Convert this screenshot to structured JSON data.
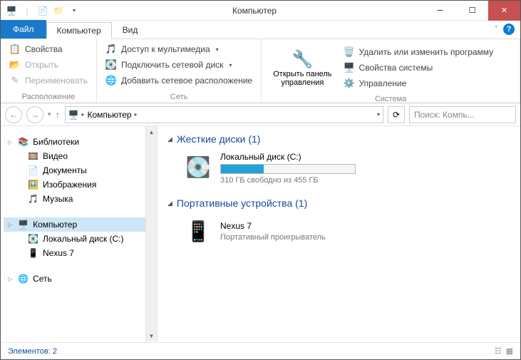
{
  "titlebar": {
    "title": "Компьютер"
  },
  "tabs": {
    "file": "Файл",
    "computer": "Компьютер",
    "view": "Вид"
  },
  "ribbon": {
    "location": {
      "properties": "Свойства",
      "open": "Открыть",
      "rename": "Переименовать",
      "label": "Расположение"
    },
    "network": {
      "media": "Доступ к мультимедиа",
      "map": "Подключить сетевой диск",
      "addloc": "Добавить сетевое расположение",
      "label": "Сеть"
    },
    "system": {
      "cp": "Открыть панель",
      "cp2": "управления",
      "uninstall": "Удалить или изменить программу",
      "props": "Свойства системы",
      "manage": "Управление",
      "label": "Система"
    }
  },
  "nav": {
    "computer": "Компьютер",
    "back_tip": "Назад",
    "fwd_tip": "Вперёд",
    "search_placeholder": "Поиск: Компь..."
  },
  "tree": {
    "libraries": "Библиотеки",
    "video": "Видео",
    "documents": "Документы",
    "pictures": "Изображения",
    "music": "Музыка",
    "computer": "Компьютер",
    "localdisk": "Локальный диск (C:)",
    "nexus": "Nexus 7",
    "network": "Сеть"
  },
  "content": {
    "hdd_header": "Жесткие диски (1)",
    "drive_name": "Локальный диск (C:)",
    "drive_free": "310 ГБ свободно из 455 ГБ",
    "drive_fill_percent": 32,
    "portable_header": "Портативные устройства (1)",
    "device_name": "Nexus 7",
    "device_type": "Портативный проигрыватель"
  },
  "status": {
    "items": "Элементов: 2"
  }
}
